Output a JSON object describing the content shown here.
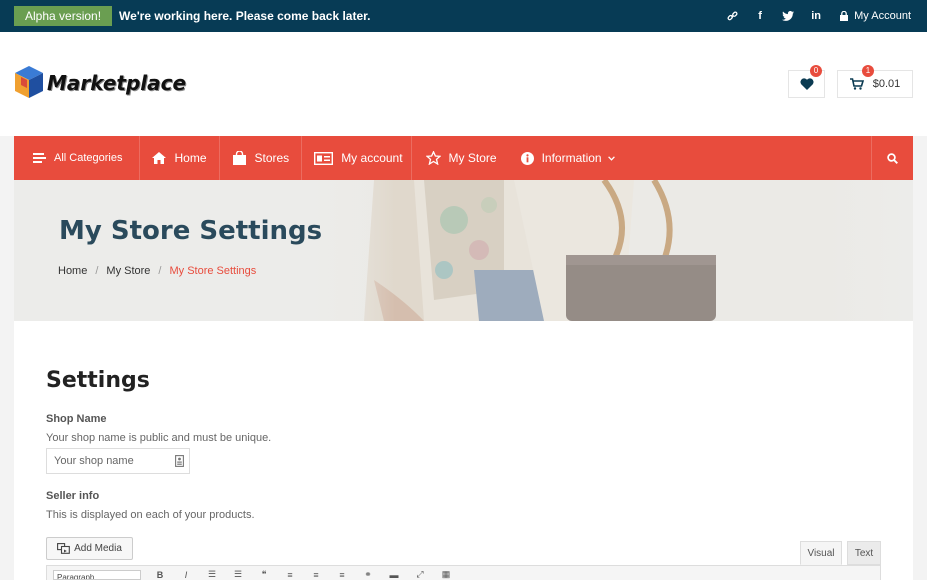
{
  "topbar": {
    "alpha_label": "Alpha version!",
    "notice": "We're working here. Please come back later.",
    "social": [
      {
        "icon": "link-icon"
      },
      {
        "icon": "facebook-icon",
        "text": "f"
      },
      {
        "icon": "twitter-icon"
      },
      {
        "icon": "linkedin-icon",
        "text": "in"
      }
    ],
    "account_label": "My Account"
  },
  "header": {
    "logo_text": "Marketplace",
    "wishlist_count": "0",
    "cart_count": "1",
    "cart_total": "$0.01"
  },
  "nav": {
    "items": [
      {
        "label": "All Categories",
        "icon": "menu-lines-icon"
      },
      {
        "label": "Home",
        "icon": "home-icon"
      },
      {
        "label": "Stores",
        "icon": "shopping-bag-icon"
      },
      {
        "label": "My account",
        "icon": "id-card-icon"
      },
      {
        "label": "My Store",
        "icon": "star-icon"
      },
      {
        "label": "Information",
        "icon": "info-circle-icon"
      }
    ]
  },
  "hero": {
    "title": "My Store Settings",
    "breadcrumb": [
      "Home",
      "My Store",
      "My Store Settings"
    ]
  },
  "main": {
    "heading": "Settings",
    "shop_name_label": "Shop Name",
    "shop_name_desc": "Your shop name is public and must be unique.",
    "shop_name_placeholder": "Your shop name",
    "seller_info_label": "Seller info",
    "seller_info_desc": "This is displayed on each of your products.",
    "add_media_label": "Add Media",
    "editor_tabs": [
      "Visual",
      "Text"
    ],
    "format_select": "Paragraph"
  },
  "colors": {
    "topbar_bg": "#073b55",
    "alpha_bg": "#6a9e51",
    "nav_bg": "#e84c3d",
    "badge": "#e84c3d"
  }
}
